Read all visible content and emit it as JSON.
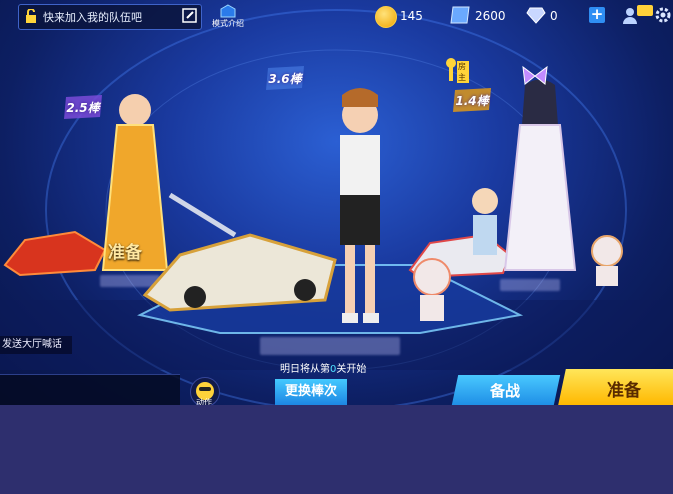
{
  "top_bar": {
    "team_invite_text": "快来加入我的队伍吧",
    "mode_intro_label": "模式介绍",
    "coins": "145",
    "cards": "2600",
    "diamonds": "0"
  },
  "players": [
    {
      "stick_tag": "2.5棒",
      "ready_label": "准备"
    },
    {
      "stick_tag": "3.6棒"
    },
    {
      "stick_tag": "1.4棒",
      "badge": "房主"
    }
  ],
  "chat": {
    "hint": "发送大厅喊话",
    "emoji_label": "动作"
  },
  "status": {
    "next_day_prefix": "明日将从第",
    "next_day_number": "0",
    "next_day_suffix": "关开始"
  },
  "buttons": {
    "change_stick": "更换棒次",
    "prepare_battle": "备战",
    "ready": "准备"
  },
  "colors": {
    "accent_blue": "#2f8ef3",
    "ready_yellow": "#ffd52f",
    "bottom_fill": "#2e2f6e"
  }
}
